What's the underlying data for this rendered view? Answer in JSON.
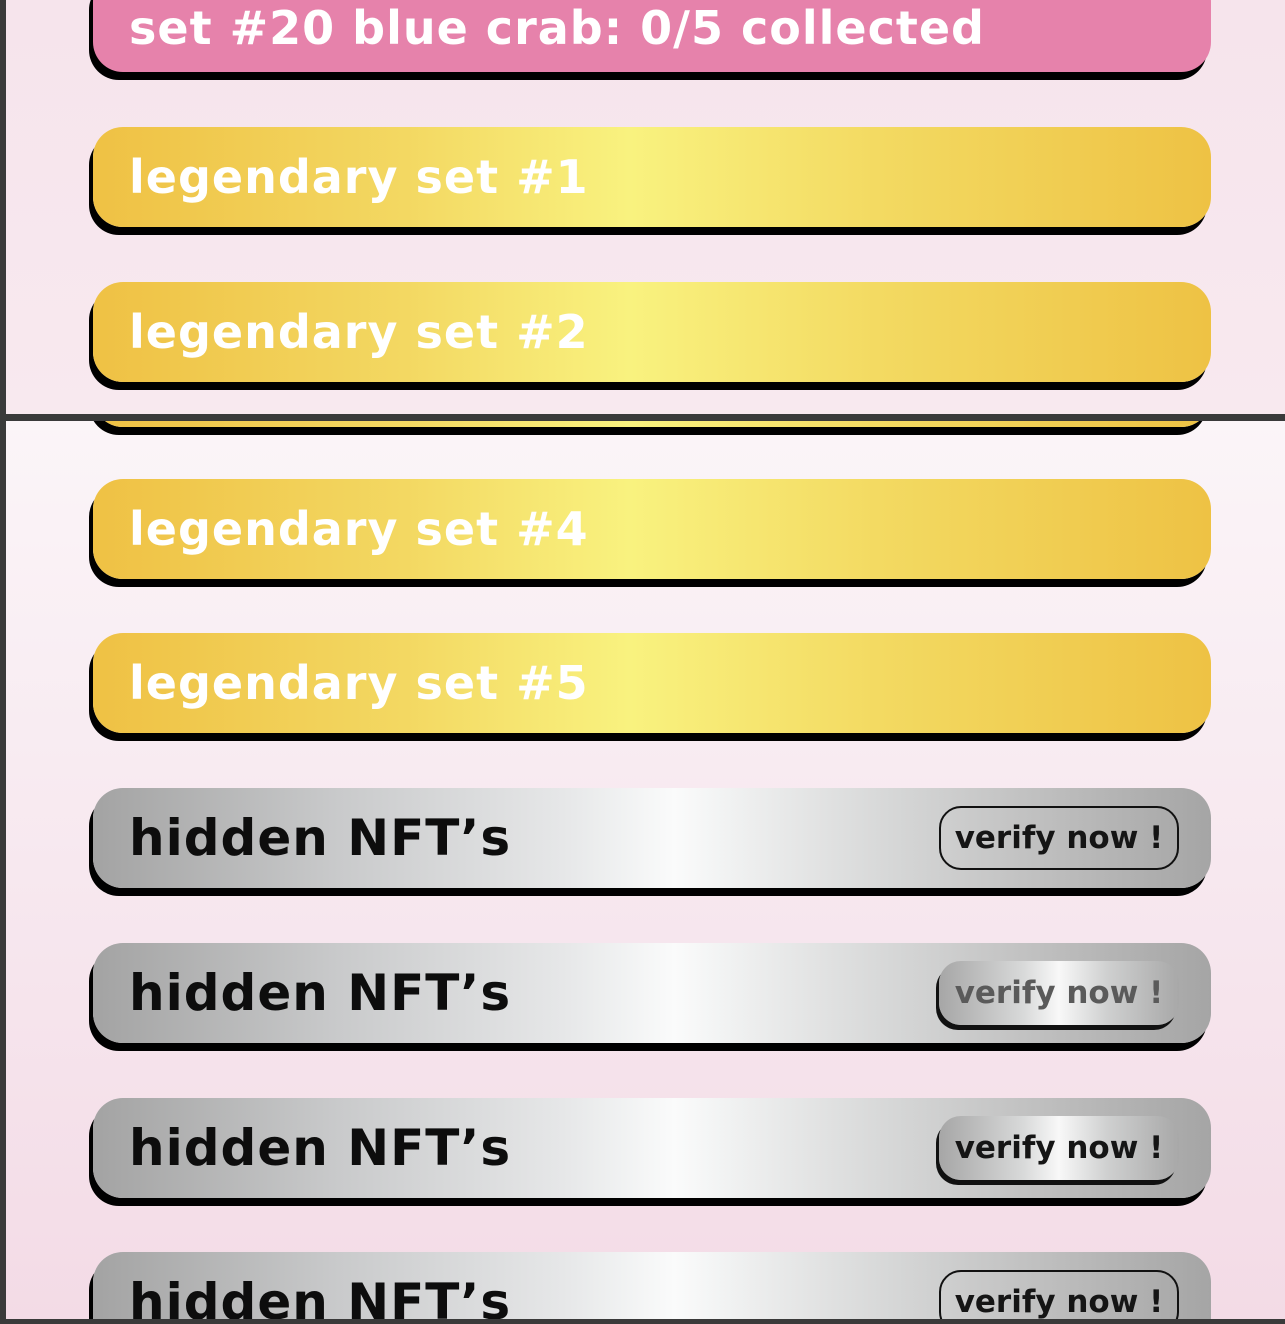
{
  "top_section": {
    "items": [
      {
        "label": "set #20 blue crab: 0/5 collected"
      },
      {
        "label": "legendary set #1"
      },
      {
        "label": "legendary set #2"
      }
    ]
  },
  "bottom_section": {
    "legendary": [
      {
        "label": "legendary set #4"
      },
      {
        "label": "legendary set #5"
      }
    ],
    "hidden": [
      {
        "label": "hidden NFT’s",
        "action": "verify now !"
      },
      {
        "label": "hidden NFT’s",
        "action": "verify now !"
      },
      {
        "label": "hidden NFT’s",
        "action": "verify now !"
      },
      {
        "label": "hidden NFT’s",
        "action": "verify now !"
      }
    ]
  },
  "colors": {
    "set_bar": "#e682ab",
    "legendary_gold": "#f9f27f",
    "hidden_silver": "#e6e7e8",
    "shadow": "#000000"
  }
}
